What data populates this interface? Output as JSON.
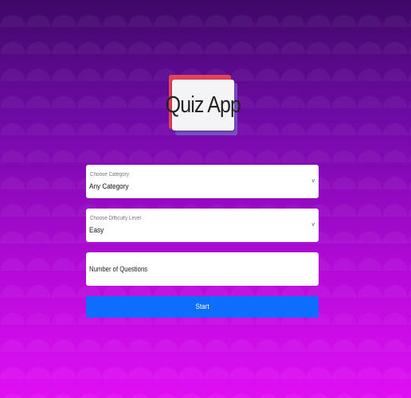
{
  "app": {
    "title": "Quiz App"
  },
  "form": {
    "category": {
      "label": "Choose Category",
      "value": "Any Category"
    },
    "difficulty": {
      "label": "Choose Difficulty Level",
      "value": "Easy"
    },
    "questions": {
      "placeholder": "Number of Questions"
    },
    "start_label": "Start"
  },
  "icons": {
    "dropdown": "chevron-down-icon"
  },
  "colors": {
    "button": "#0d6efd",
    "bg_top": "#3e0866",
    "bg_bottom": "#e010f4"
  }
}
